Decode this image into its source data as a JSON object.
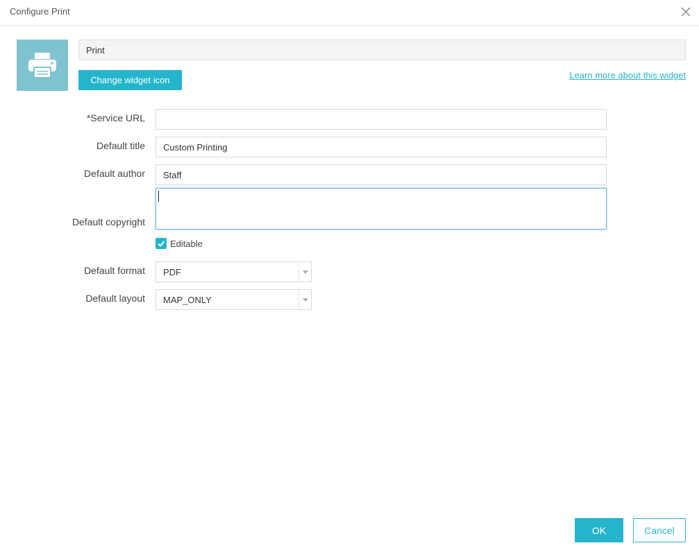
{
  "dialog": {
    "title": "Configure Print",
    "close_icon": "close-icon"
  },
  "widget": {
    "icon": "printer-icon",
    "icon_tile_color": "#7ec3cf",
    "name_value": "Print",
    "change_icon_label": "Change widget icon",
    "learn_more_label": "Learn more about this widget"
  },
  "form": {
    "service_url": {
      "label": "*Service URL",
      "value": ""
    },
    "default_title": {
      "label": "Default title",
      "value": "Custom Printing"
    },
    "default_author": {
      "label": "Default author",
      "value": "Staff"
    },
    "default_copyright": {
      "label": "Default copyright",
      "value": ""
    },
    "editable": {
      "label": "Editable",
      "checked": true
    },
    "default_format": {
      "label": "Default format",
      "value": "PDF"
    },
    "default_layout": {
      "label": "Default layout",
      "value": "MAP_ONLY"
    }
  },
  "footer": {
    "ok_label": "OK",
    "cancel_label": "Cancel"
  },
  "colors": {
    "accent": "#24b5cc",
    "focus_border": "#6fb7e0"
  }
}
